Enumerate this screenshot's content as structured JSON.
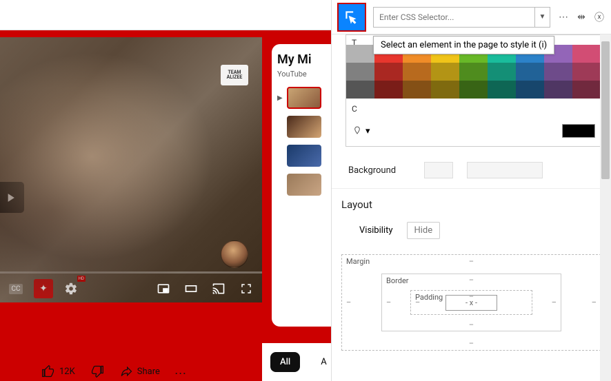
{
  "playlist": {
    "title_partial": "My Mi",
    "subtitle": "YouTube",
    "watermark_line1": "TEAM",
    "watermark_line2": "ALIZEE"
  },
  "actions": {
    "chip_all": "All",
    "chip_a": "A",
    "likes": "12K",
    "share": "Share",
    "more": "..."
  },
  "inspector": {
    "selector_placeholder": "Enter CSS Selector...",
    "tooltip": "Select an element in the page to style it (i)",
    "palette_tab_t": "T",
    "palette_tab_c": "C",
    "background_label": "Background",
    "layout_label": "Layout",
    "visibility_label": "Visibility",
    "hide_label": "Hide",
    "box": {
      "margin": "Margin",
      "border": "Border",
      "padding": "Padding",
      "center": "- x -",
      "dash": "–"
    },
    "swatches_row1": [
      "#b3b3b3",
      "#e8362e",
      "#f08c28",
      "#f0c419",
      "#68b828",
      "#1abc9c",
      "#2c82c9",
      "#9365b8",
      "#d24d74"
    ],
    "swatches_row2": [
      "#808080",
      "#aa2822",
      "#b86a1e",
      "#b39415",
      "#4f8c1e",
      "#148f76",
      "#216297",
      "#6e4b8a",
      "#9e3a57"
    ],
    "swatches_row3": [
      "#555555",
      "#7a1d18",
      "#845016",
      "#7f6a0f",
      "#386415",
      "#0e6654",
      "#17466c",
      "#4f3663",
      "#71293e"
    ]
  }
}
